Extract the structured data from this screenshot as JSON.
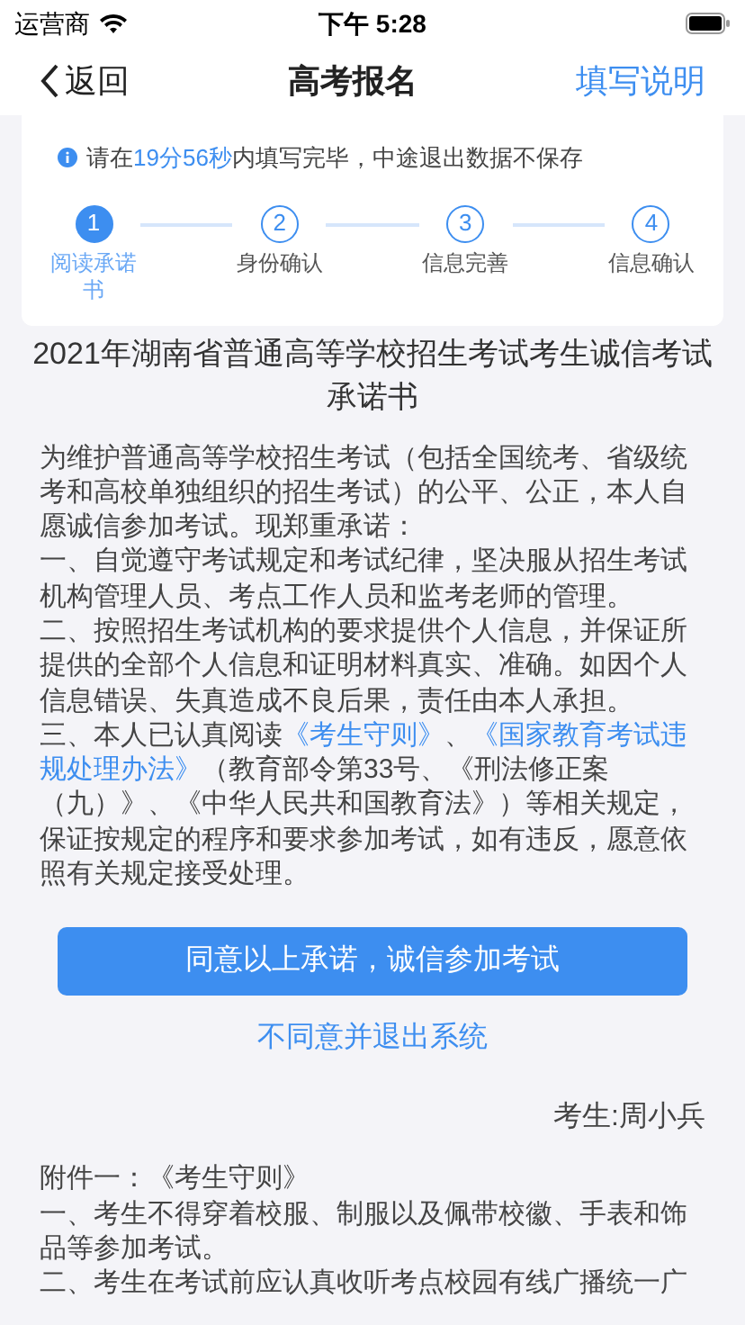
{
  "status_bar": {
    "carrier": "运营商",
    "time": "下午 5:28"
  },
  "nav": {
    "back": "返回",
    "title": "高考报名",
    "action": "填写说明"
  },
  "notice": {
    "before": "请在",
    "countdown": "19分56秒",
    "after": "内填写完毕，中途退出数据不保存"
  },
  "steps": [
    {
      "number": "1",
      "label": "阅读承诺书",
      "selected": true
    },
    {
      "number": "2",
      "label": "身份确认",
      "selected": false
    },
    {
      "number": "3",
      "label": "信息完善",
      "selected": false
    },
    {
      "number": "4",
      "label": "信息确认",
      "selected": false
    }
  ],
  "document": {
    "title": "2021年湖南省普通高等学校招生考试考生诚信考试承诺书",
    "paragraphs": [
      [
        {
          "kind": "text",
          "text": "为维护普通高等学校招生考试（包括全国统考、省级统考和高校单独组织的招生考试）的公平、公正，本人自愿诚信参加考试。现郑重承诺："
        }
      ],
      [
        {
          "kind": "text",
          "text": "一、自觉遵守考试规定和考试纪律，坚决服从招生考试机构管理人员、考点工作人员和监考老师的管理。"
        }
      ],
      [
        {
          "kind": "text",
          "text": "二、按照招生考试机构的要求提供个人信息，并保证所提供的全部个人信息和证明材料真实、准确。如因个人信息错误、失真造成不良后果，责任由本人承担。"
        }
      ],
      [
        {
          "kind": "text",
          "text": "三、本人已认真阅读"
        },
        {
          "kind": "link",
          "text": "《考生守则》"
        },
        {
          "kind": "text",
          "text": "、"
        },
        {
          "kind": "link",
          "text": "《国家教育考试违"
        },
        {
          "kind": "link",
          "text": "规处理办法》"
        },
        {
          "kind": "text",
          "text": "（教育部令第33号、《刑法修正案（九）》、《中华人民共和国教育法》）等相关规定，保证按规定的程序和要求参加考试，如有违反，愿意依照有关规定接受处理。"
        }
      ]
    ]
  },
  "agree_button": "同意以上承诺，诚信参加考试",
  "decline_link": "不同意并退出系统",
  "signature": "考生:周小兵",
  "annex": {
    "title": "附件一：《考生守则》",
    "paragraphs": [
      "一、考生不得穿着校服、制服以及佩带校徽、手表和饰品等参加考试。",
      "二、考生在考试前应认真收听考点校园有线广播统一广"
    ]
  }
}
